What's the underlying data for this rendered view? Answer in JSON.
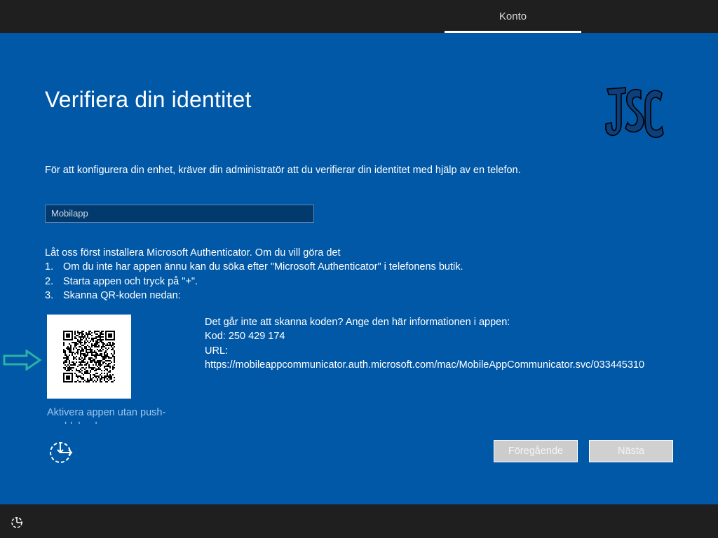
{
  "topbar": {
    "tab_label": "Konto"
  },
  "main": {
    "title": "Verifiera din identitet",
    "logo_text": "JSC",
    "description": "För att konfigurera din enhet, kräver din administratör att du verifierar din identitet med hjälp av en telefon.",
    "method_select": {
      "value": "Mobilapp"
    },
    "instructions": {
      "intro": "Låt oss först installera Microsoft Authenticator. Om du vill göra det",
      "steps": [
        {
          "num": "1.",
          "text": "Om du inte har appen ännu kan du söka efter \"Microsoft Authenticator\" i telefonens butik."
        },
        {
          "num": "2.",
          "text": "Starta appen och tryck på \"+\"."
        },
        {
          "num": "3.",
          "text": "Skanna QR-koden nedan:"
        }
      ]
    },
    "alt_info": {
      "heading": "Det går inte att skanna koden? Ange den här informationen i appen:",
      "code_line": "Kod: 250 429 174",
      "url_label": "URL:",
      "url_value": "https://mobileappcommunicator.auth.microsoft.com/mac/MobileAppCommunicator.svc/033445310"
    },
    "push_link": "Aktivera appen utan push-meddelanden"
  },
  "buttons": {
    "previous": "Föregående",
    "next": "Nästa"
  },
  "colors": {
    "main_bg": "#0158a7",
    "bar_bg": "#1f1f1f",
    "link": "#9ec7ee",
    "arrow": "#2bb1a6"
  }
}
